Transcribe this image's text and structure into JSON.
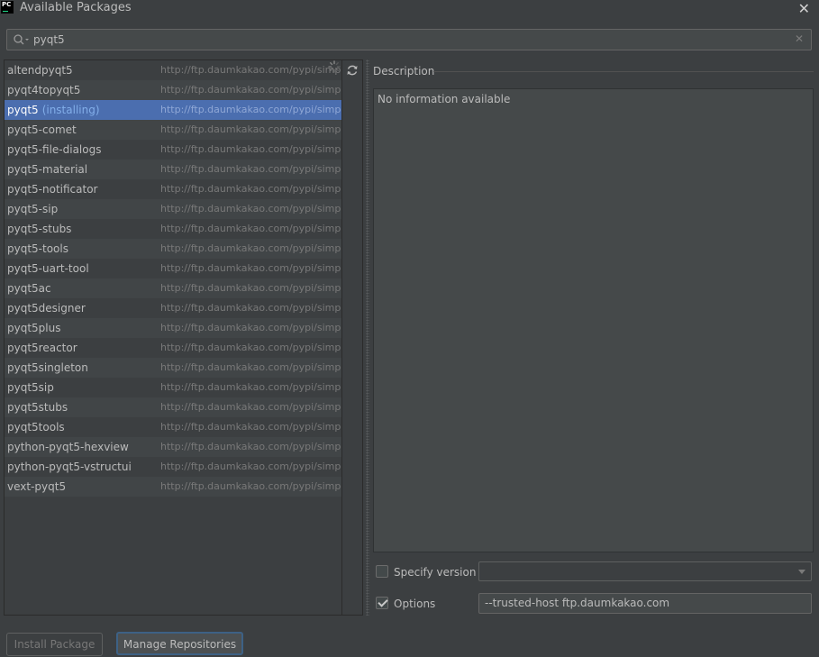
{
  "window": {
    "title": "Available Packages",
    "app_icon_text": "PC"
  },
  "search": {
    "value": "pyqt5"
  },
  "packages": [
    {
      "name": "altendpyqt5",
      "repo": "http://ftp.daumkakao.com/pypi/simple/",
      "status": ""
    },
    {
      "name": "pyqt4topyqt5",
      "repo": "http://ftp.daumkakao.com/pypi/simple/",
      "status": ""
    },
    {
      "name": "pyqt5",
      "repo": "http://ftp.daumkakao.com/pypi/simple/",
      "status": "(installing)"
    },
    {
      "name": "pyqt5-comet",
      "repo": "http://ftp.daumkakao.com/pypi/simple/",
      "status": ""
    },
    {
      "name": "pyqt5-file-dialogs",
      "repo": "http://ftp.daumkakao.com/pypi/simple/",
      "status": ""
    },
    {
      "name": "pyqt5-material",
      "repo": "http://ftp.daumkakao.com/pypi/simple/",
      "status": ""
    },
    {
      "name": "pyqt5-notificator",
      "repo": "http://ftp.daumkakao.com/pypi/simple/",
      "status": ""
    },
    {
      "name": "pyqt5-sip",
      "repo": "http://ftp.daumkakao.com/pypi/simple/",
      "status": ""
    },
    {
      "name": "pyqt5-stubs",
      "repo": "http://ftp.daumkakao.com/pypi/simple/",
      "status": ""
    },
    {
      "name": "pyqt5-tools",
      "repo": "http://ftp.daumkakao.com/pypi/simple/",
      "status": ""
    },
    {
      "name": "pyqt5-uart-tool",
      "repo": "http://ftp.daumkakao.com/pypi/simple/",
      "status": ""
    },
    {
      "name": "pyqt5ac",
      "repo": "http://ftp.daumkakao.com/pypi/simple/",
      "status": ""
    },
    {
      "name": "pyqt5designer",
      "repo": "http://ftp.daumkakao.com/pypi/simple/",
      "status": ""
    },
    {
      "name": "pyqt5plus",
      "repo": "http://ftp.daumkakao.com/pypi/simple/",
      "status": ""
    },
    {
      "name": "pyqt5reactor",
      "repo": "http://ftp.daumkakao.com/pypi/simple/",
      "status": ""
    },
    {
      "name": "pyqt5singleton",
      "repo": "http://ftp.daumkakao.com/pypi/simple/",
      "status": ""
    },
    {
      "name": "pyqt5sip",
      "repo": "http://ftp.daumkakao.com/pypi/simple/",
      "status": ""
    },
    {
      "name": "pyqt5stubs",
      "repo": "http://ftp.daumkakao.com/pypi/simple/",
      "status": ""
    },
    {
      "name": "pyqt5tools",
      "repo": "http://ftp.daumkakao.com/pypi/simple/",
      "status": ""
    },
    {
      "name": "python-pyqt5-hexview",
      "repo": "http://ftp.daumkakao.com/pypi/simple/",
      "status": ""
    },
    {
      "name": "python-pyqt5-vstructui",
      "repo": "http://ftp.daumkakao.com/pypi/simple/",
      "status": ""
    },
    {
      "name": "vext-pyqt5",
      "repo": "http://ftp.daumkakao.com/pypi/simple/",
      "status": ""
    }
  ],
  "selected_package": "pyqt5",
  "description": {
    "title": "Description",
    "text": "No information available"
  },
  "specify_version": {
    "label": "Specify version",
    "checked": false,
    "value": ""
  },
  "options": {
    "label": "Options",
    "checked": true,
    "value": "--trusted-host ftp.daumkakao.com"
  },
  "buttons": {
    "install": "Install Package",
    "manage": "Manage Repositories"
  },
  "colors": {
    "background": "#3c3f41",
    "selection": "#4b6eaf",
    "installing_status": "#82aee9",
    "focus_border": "#3d6185"
  },
  "icons": {
    "search": "search-icon",
    "clear": "clear-icon",
    "loading": "loading-spinner-icon",
    "refresh": "refresh-icon",
    "close": "close-icon"
  }
}
